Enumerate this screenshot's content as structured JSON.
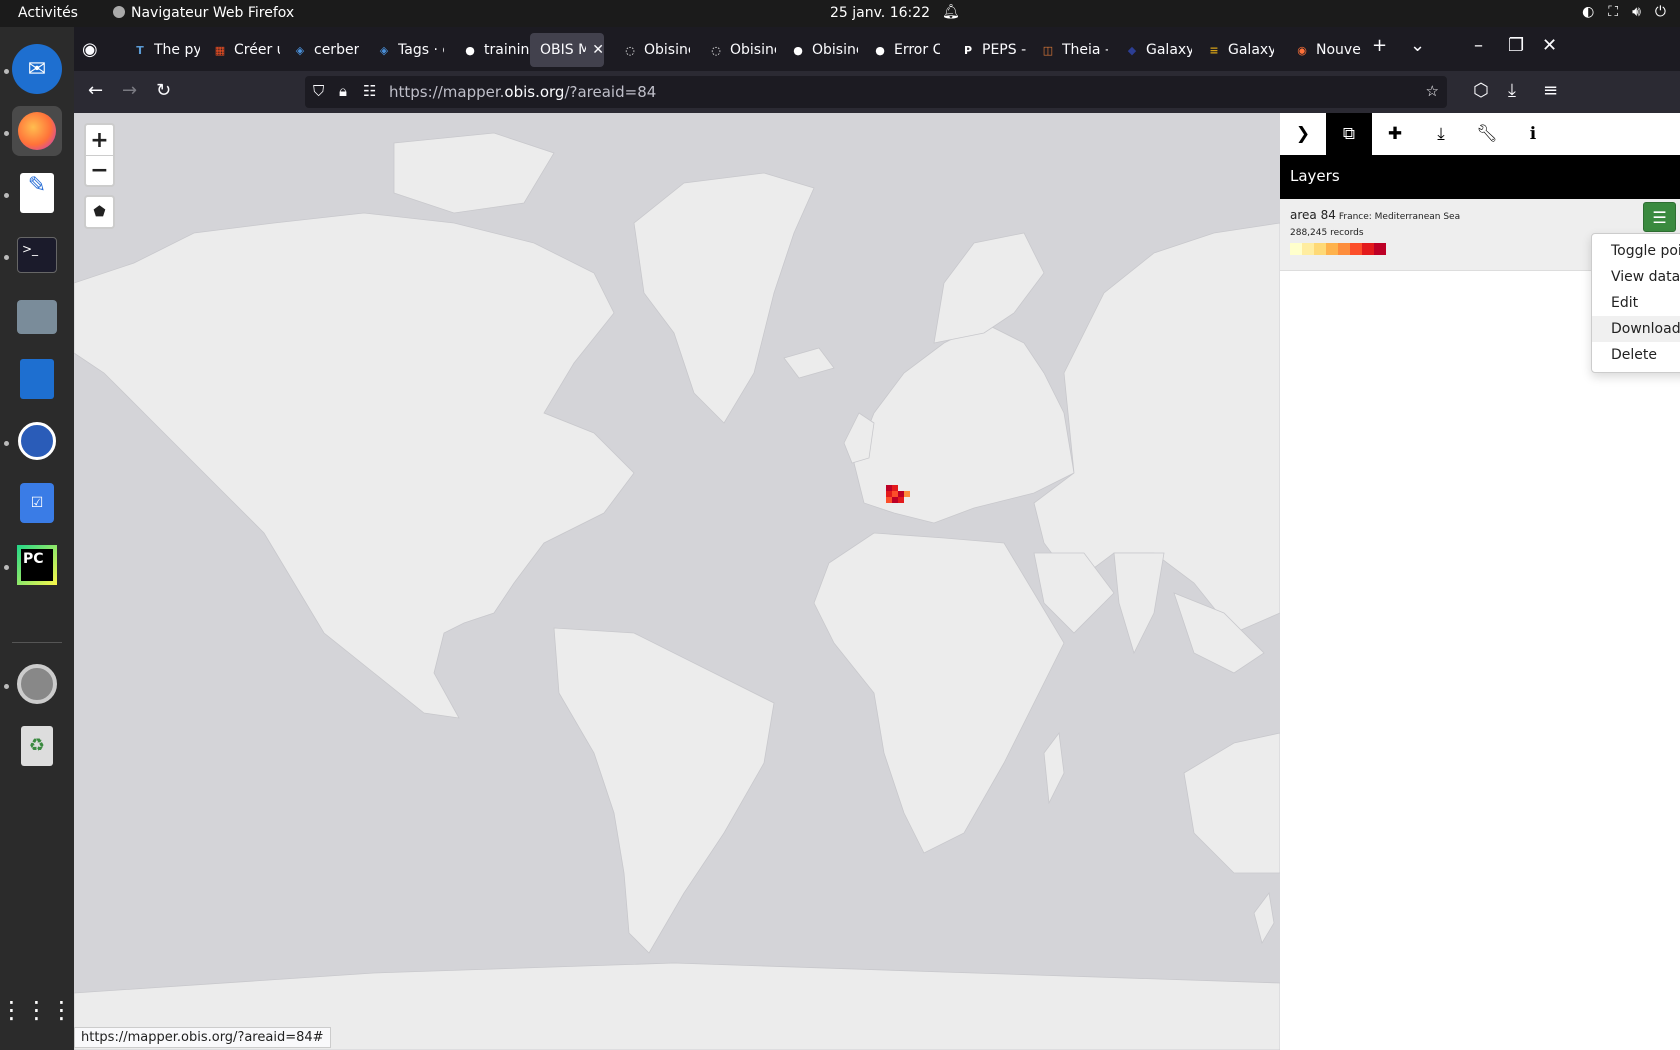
{
  "system": {
    "activities": "Activités",
    "app_name": "Navigateur Web Firefox",
    "datetime": "25 janv.  16:22"
  },
  "tabs": [
    {
      "label": "The py",
      "icon": "T",
      "color": "#5b9bd5"
    },
    {
      "label": "Créer u",
      "icon": "▦",
      "color": "#f25022"
    },
    {
      "label": "cerber",
      "icon": "◈",
      "color": "#4a90d9"
    },
    {
      "label": "Tags · e",
      "icon": "◈",
      "color": "#4a90d9"
    },
    {
      "label": "trainin",
      "icon": "●",
      "color": "#ffffff"
    },
    {
      "label": "OBIS Ma",
      "icon": "",
      "color": "#ffffff"
    },
    {
      "label": "Obisinc",
      "icon": "◌",
      "color": "#ffffff"
    },
    {
      "label": "Obisinc",
      "icon": "◌",
      "color": "#ffffff"
    },
    {
      "label": "Obisinc",
      "icon": "●",
      "color": "#ffffff"
    },
    {
      "label": "Error C",
      "icon": "●",
      "color": "#ffffff"
    },
    {
      "label": "PEPS -",
      "icon": "P",
      "color": "#ffffff"
    },
    {
      "label": "Theia -",
      "icon": "◫",
      "color": "#e07b39"
    },
    {
      "label": "Galaxy",
      "icon": "◆",
      "color": "#2c3e94"
    },
    {
      "label": "Galaxy",
      "icon": "≡",
      "color": "#d4a017"
    },
    {
      "label": "Nouvel",
      "icon": "◉",
      "color": "#ff7139"
    }
  ],
  "url": {
    "prefix": "https://mapper.",
    "domain": "obis.org",
    "suffix": "/?areaid=84"
  },
  "status_url": "https://mapper.obis.org/?areaid=84#",
  "panel": {
    "title": "Layers",
    "layer": {
      "name": "area 84",
      "region": "France: Mediterranean Sea",
      "records": "288,245 records",
      "legend_colors": [
        "#ffffcc",
        "#ffeda0",
        "#fed976",
        "#feb24c",
        "#fd8d3c",
        "#fc4e2a",
        "#e31a1c",
        "#bd0026"
      ]
    }
  },
  "menu": {
    "items": [
      "Toggle points",
      "View data",
      "Edit",
      "Download",
      "Delete"
    ],
    "hovered": "Download"
  },
  "colors": {
    "map_sea": "#d4d4d8",
    "map_land": "#ececec",
    "occurrence": "#c83c50",
    "menu_button": "#3a8a3f"
  }
}
